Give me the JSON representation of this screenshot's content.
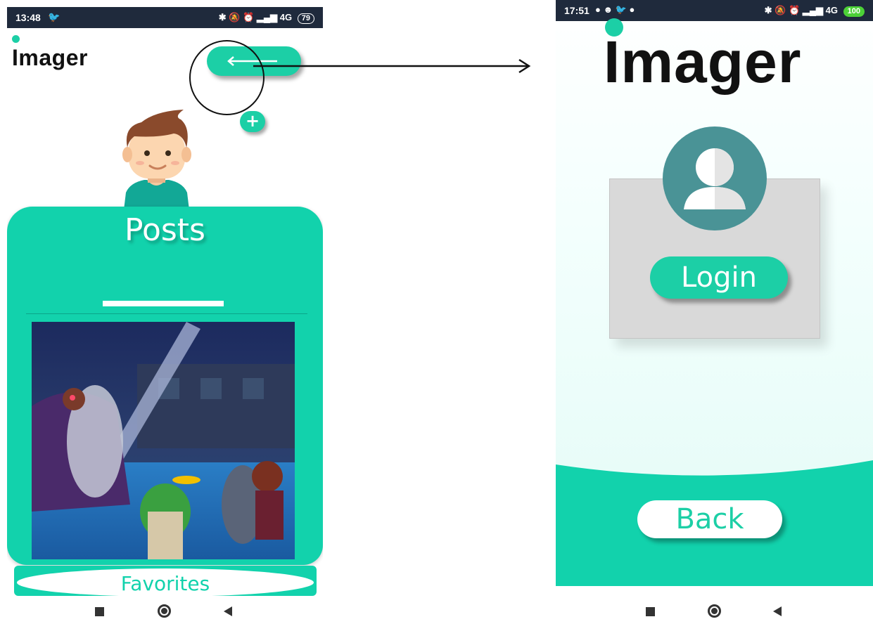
{
  "left_screen": {
    "status_bar": {
      "time": "13:48",
      "icons": [
        "twitter-icon",
        "bluetooth-icon",
        "mute-icon",
        "alarm-icon",
        "signal-icon"
      ],
      "network": "4G",
      "battery": "79"
    },
    "app_title": "Imager",
    "back_button": {
      "icon": "arrow-left-icon"
    },
    "add_button": {
      "label": "+"
    },
    "section_title": "Posts",
    "favorites_label": "Favorites",
    "accent_color": "#12d2ac"
  },
  "right_screen": {
    "status_bar": {
      "time": "17:51",
      "icons": [
        "dot-icon",
        "reddit-icon",
        "twitter-icon",
        "dot-icon",
        "bluetooth-icon",
        "mute-icon",
        "alarm-icon",
        "signal-icon"
      ],
      "network": "4G",
      "battery": "100"
    },
    "app_title": "Imager",
    "login_label": "Login",
    "back_label": "Back",
    "accent_color": "#1ccfa6",
    "avatar_color": "#4a9396"
  },
  "nav_bar": {
    "buttons": [
      "recent-apps-icon",
      "home-icon",
      "back-icon"
    ]
  }
}
